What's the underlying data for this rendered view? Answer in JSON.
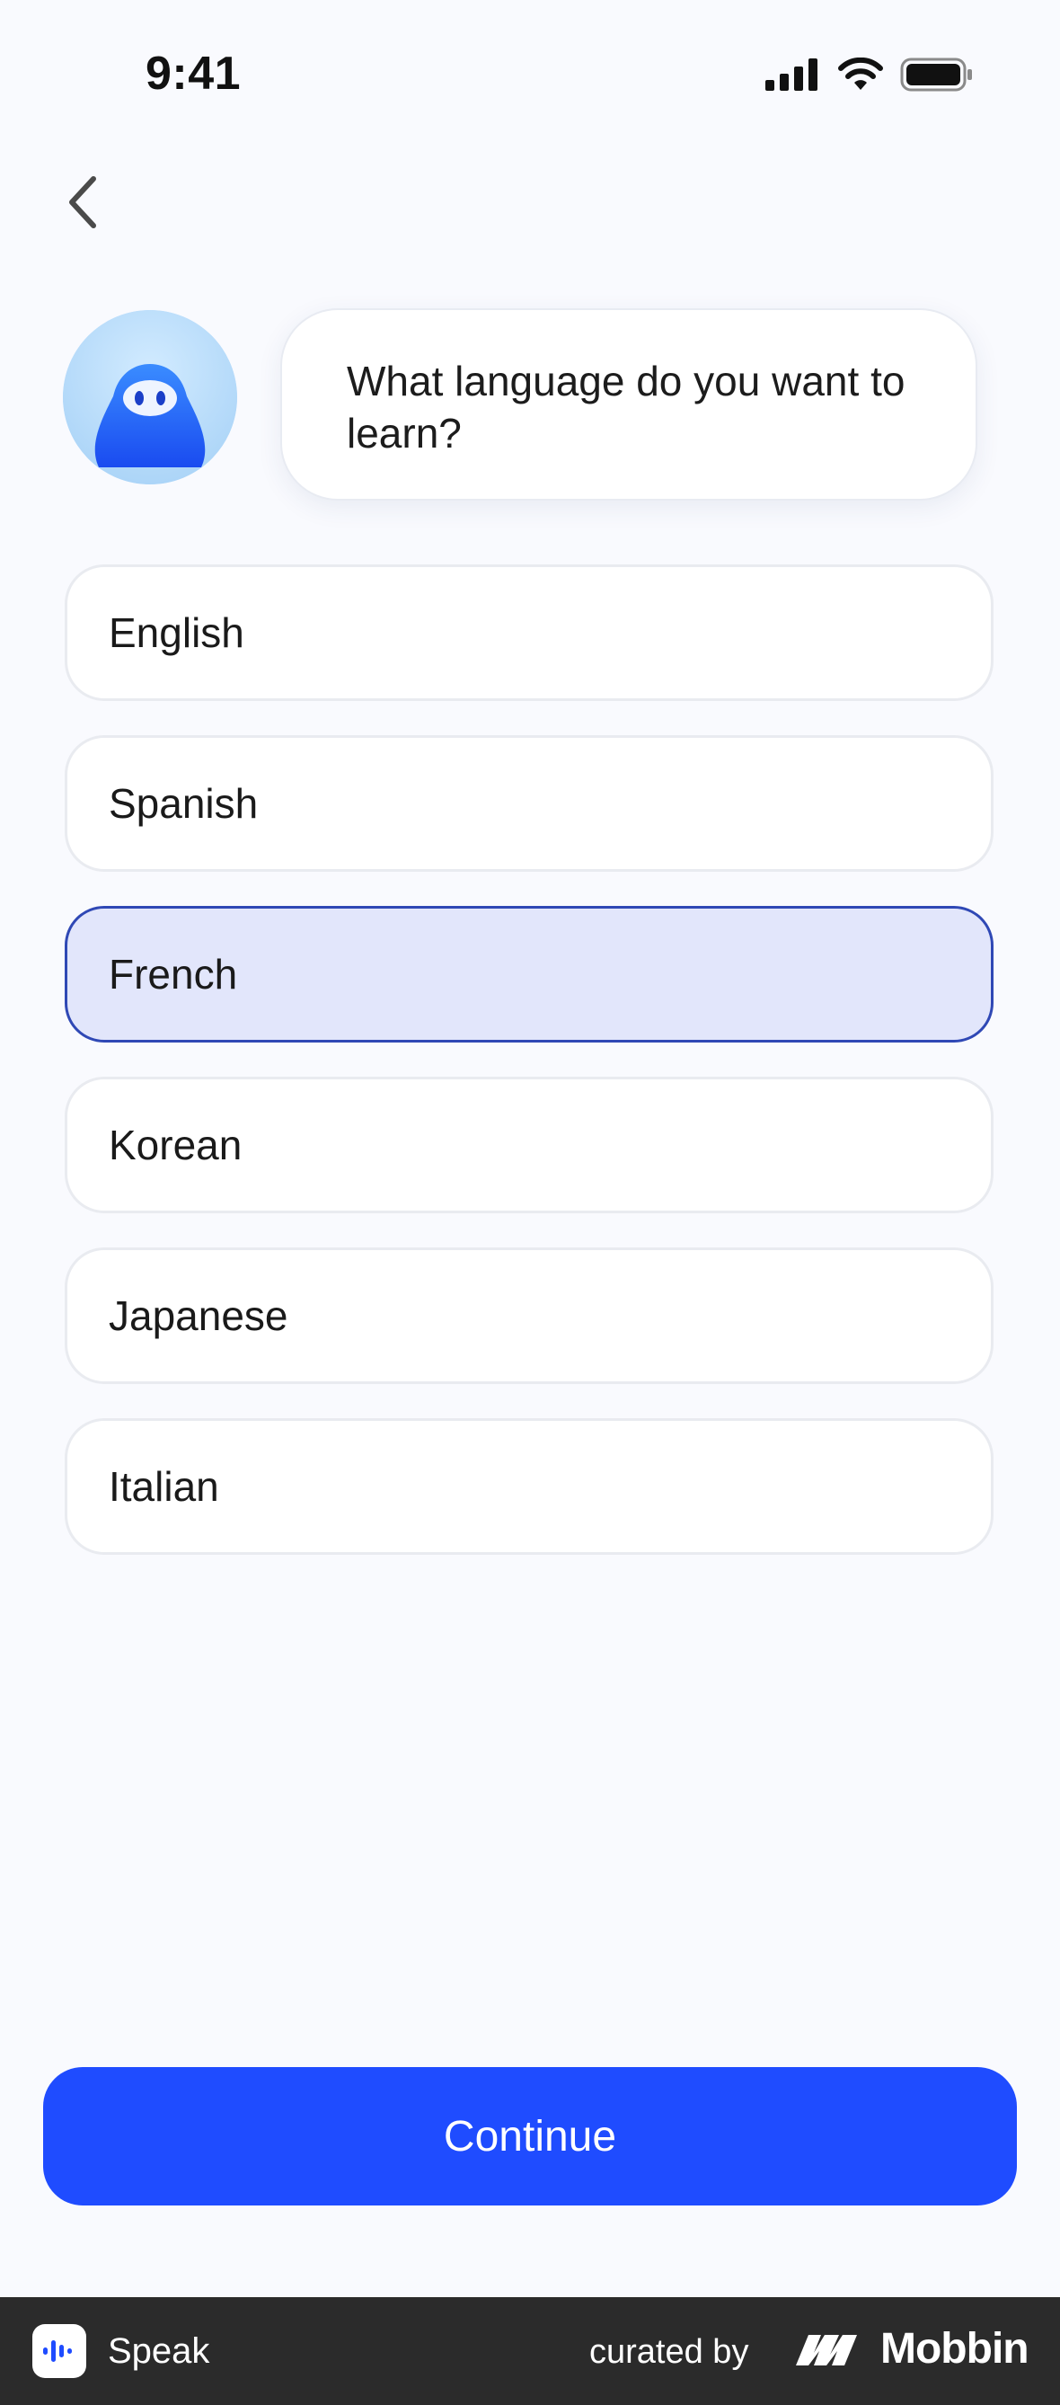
{
  "status_bar": {
    "time": "9:41",
    "icons": [
      "cellular-signal-icon",
      "wifi-icon",
      "battery-icon"
    ]
  },
  "nav": {
    "back_icon": "chevron-left-icon"
  },
  "prompt": {
    "avatar": "speak-mascot-avatar",
    "question": "What language do you want to learn?"
  },
  "options": [
    {
      "label": "English",
      "selected": false
    },
    {
      "label": "Spanish",
      "selected": false
    },
    {
      "label": "French",
      "selected": true
    },
    {
      "label": "Korean",
      "selected": false
    },
    {
      "label": "Japanese",
      "selected": false
    },
    {
      "label": "Italian",
      "selected": false
    }
  ],
  "continue_label": "Continue",
  "footer": {
    "app_name": "Speak",
    "curated_by": "curated by",
    "brand": "Mobbin"
  },
  "colors": {
    "background": "#f9fafe",
    "accent": "#1f4cff",
    "selected_fill": "#e2e6fb",
    "selected_border": "#2f48b5",
    "footer": "#2b2b2b"
  }
}
